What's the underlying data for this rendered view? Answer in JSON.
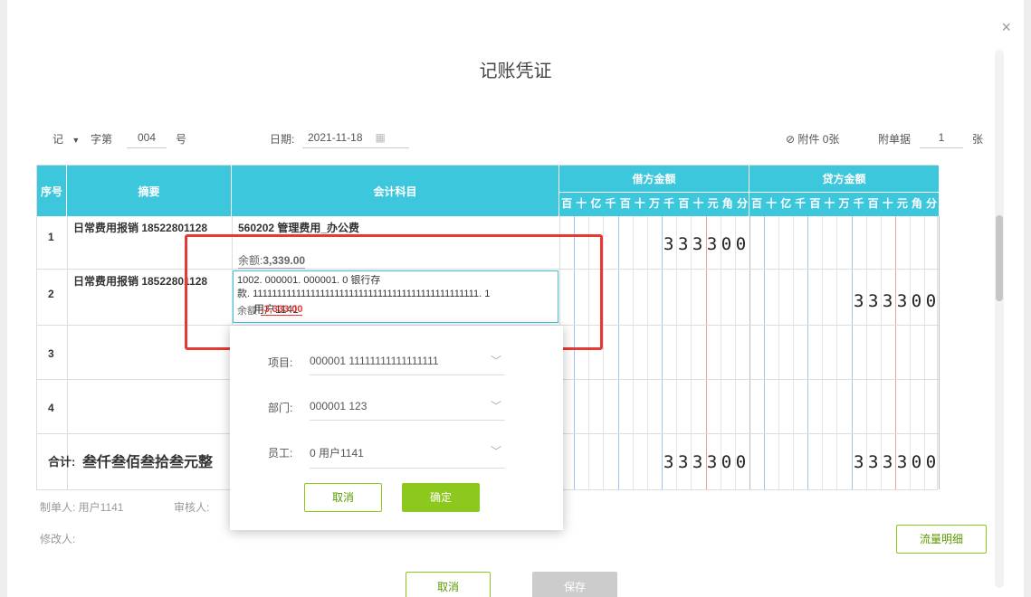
{
  "dialog": {
    "title": "记账凭证",
    "close": "×"
  },
  "header": {
    "voucher_word": "记",
    "dropdown": "▼",
    "zi": "字第",
    "number": "004",
    "hao": "号",
    "date_label": "日期:",
    "date_value": "2021-11-18",
    "attach_label": "附件 0张",
    "docs_label": "附单据",
    "docs_value": "1",
    "zhang": "张"
  },
  "table": {
    "col_seq": "序号",
    "col_summary": "摘要",
    "col_subject": "会计科目",
    "col_debit": "借方金额",
    "col_credit": "贷方金额",
    "digits": [
      "百",
      "十",
      "亿",
      "千",
      "百",
      "十",
      "万",
      "千",
      "百",
      "十",
      "元",
      "角",
      "分"
    ],
    "rows": [
      {
        "seq": "1",
        "summary": "日常费用报销 18522801128",
        "subject": "560202 管理费用_办公费",
        "balance_label": "余额:",
        "balance": "3,339.00",
        "debit": "333300",
        "credit": ""
      },
      {
        "seq": "2",
        "summary": "日常费用报销 18522801128",
        "subject_l1": "1002. 000001. 000001. 0   银行存",
        "subject_l2": "款. 11111111111111111111111111111111111111111111111. 1",
        "subject_l3": "余额",
        "user_overlay": "用户1141",
        "balance": "-3,333.00",
        "debit": "",
        "credit": "333300"
      },
      {
        "seq": "3"
      },
      {
        "seq": "4"
      }
    ],
    "total_label": "合计:",
    "total_text": "叁仟叁佰叁拾叁元整",
    "total_debit": "333300",
    "total_credit": "333300"
  },
  "popup": {
    "project_label": "项目:",
    "project_value": "000001  11111111111111111",
    "dept_label": "部门:",
    "dept_value": "000001  123",
    "emp_label": "员工:",
    "emp_value": "0  用户1141",
    "cancel": "取消",
    "confirm": "确定"
  },
  "footer": {
    "maker": "制单人: 用户1141",
    "auditor": "审核人:",
    "modifier": "修改人:",
    "flow_detail": "流量明细",
    "cancel": "取消",
    "save": "保存"
  },
  "colors": {
    "header_teal": "#3cc7dd",
    "confirm_green": "#8cc81e",
    "highlight_red": "#e53935"
  }
}
